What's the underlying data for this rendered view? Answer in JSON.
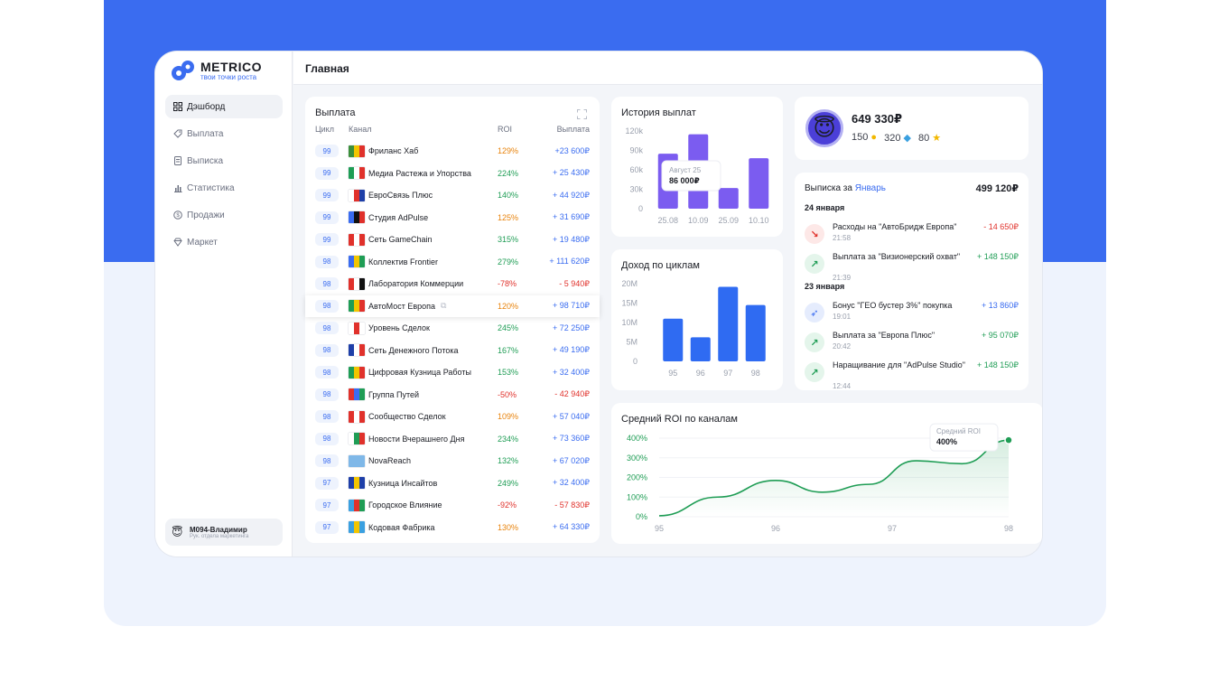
{
  "app": {
    "logo_title": "METRICO",
    "logo_subtitle": "твои точки роста",
    "accent": "#3a6cf0"
  },
  "header": {
    "title": "Главная"
  },
  "sidebar": {
    "items": [
      {
        "label": "Дэшборд",
        "icon": "dashboard-icon",
        "active": true
      },
      {
        "label": "Выплата",
        "icon": "tag-icon"
      },
      {
        "label": "Выписка",
        "icon": "document-icon"
      },
      {
        "label": "Статистика",
        "icon": "bar-chart-icon"
      },
      {
        "label": "Продажи",
        "icon": "coin-icon"
      },
      {
        "label": "Маркет",
        "icon": "diamond-icon"
      }
    ],
    "user": {
      "name": "M094-Владимир",
      "role": "Рук. отдела маркетинга"
    }
  },
  "payouts": {
    "title": "Выплата",
    "columns": [
      "Цикл",
      "Канал",
      "ROI",
      "Выплата"
    ],
    "rows": [
      {
        "cycle": "99",
        "channel": "Фриланс Хаб",
        "roi": "129%",
        "amount": "+23 600₽",
        "tone": "orange",
        "flag": [
          "#3b8f3b",
          "#f2c500",
          "#e0312b"
        ]
      },
      {
        "cycle": "99",
        "channel": "Медиа Растежа и Упорства",
        "roi": "224%",
        "amount": "+ 25 430₽",
        "tone": "green",
        "flag": [
          "#1f9d55",
          "#ffffff",
          "#e0312b"
        ]
      },
      {
        "cycle": "99",
        "channel": "ЕвроСвязь Плюс",
        "roi": "140%",
        "amount": "+ 44 920₽",
        "tone": "green",
        "flag": [
          "#ffffff",
          "#e0312b",
          "#1e3fa8"
        ]
      },
      {
        "cycle": "99",
        "channel": "Студия AdPulse",
        "roi": "125%",
        "amount": "+ 31 690₽",
        "tone": "orange",
        "flag": [
          "#3a6cf0",
          "#111111",
          "#e0312b"
        ]
      },
      {
        "cycle": "99",
        "channel": "Сеть GameChain",
        "roi": "315%",
        "amount": "+ 19 480₽",
        "tone": "green",
        "flag": [
          "#e0312b",
          "#ffffff",
          "#e0312b"
        ]
      },
      {
        "cycle": "98",
        "channel": "Коллектив Frontier",
        "roi": "279%",
        "amount": "+ 111 620₽",
        "tone": "green",
        "flag": [
          "#3a6cf0",
          "#f2c500",
          "#1f9d55"
        ]
      },
      {
        "cycle": "98",
        "channel": "Лаборатория Коммерции",
        "roi": "-78%",
        "amount": "- 5 940₽",
        "tone": "red",
        "flag": [
          "#e0312b",
          "#ffffff",
          "#111111"
        ]
      },
      {
        "cycle": "98",
        "channel": "АвтоМост Европа",
        "roi": "120%",
        "amount": "+ 98 710₽",
        "tone": "orange",
        "flag": [
          "#1f9d55",
          "#f2c500",
          "#e0312b"
        ]
      },
      {
        "cycle": "98",
        "channel": "Уровень Сделок",
        "roi": "245%",
        "amount": "+ 72 250₽",
        "tone": "green",
        "flag": [
          "#ffffff",
          "#e0312b",
          "#ffffff"
        ]
      },
      {
        "cycle": "98",
        "channel": "Сеть Денежного Потока",
        "roi": "167%",
        "amount": "+ 49 190₽",
        "tone": "green",
        "flag": [
          "#1e3fa8",
          "#ffffff",
          "#e0312b"
        ]
      },
      {
        "cycle": "98",
        "channel": "Цифровая Кузница Работы",
        "roi": "153%",
        "amount": "+ 32 400₽",
        "tone": "green",
        "flag": [
          "#1f9d55",
          "#f2c500",
          "#e0312b"
        ]
      },
      {
        "cycle": "98",
        "channel": "Группа Путей",
        "roi": "-50%",
        "amount": "- 42 940₽",
        "tone": "red",
        "flag": [
          "#e0312b",
          "#3a6cf0",
          "#1f9d55"
        ]
      },
      {
        "cycle": "98",
        "channel": "Сообщество Сделок",
        "roi": "109%",
        "amount": "+ 57 040₽",
        "tone": "orange",
        "flag": [
          "#e0312b",
          "#ffffff",
          "#e0312b"
        ]
      },
      {
        "cycle": "98",
        "channel": "Новости Вчерашнего Дня",
        "roi": "234%",
        "amount": "+ 73 360₽",
        "tone": "green",
        "flag": [
          "#ffffff",
          "#1f9d55",
          "#e0312b"
        ]
      },
      {
        "cycle": "98",
        "channel": "NovaReach",
        "roi": "132%",
        "amount": "+ 67 020₽",
        "tone": "green",
        "flag": [
          "#7fb8e8",
          "#7fb8e8",
          "#7fb8e8"
        ]
      },
      {
        "cycle": "97",
        "channel": "Кузница Инсайтов",
        "roi": "249%",
        "amount": "+ 32 400₽",
        "tone": "green",
        "flag": [
          "#1e3fa8",
          "#f2c500",
          "#1e3fa8"
        ]
      },
      {
        "cycle": "97",
        "channel": "Городское Влияние",
        "roi": "-92%",
        "amount": "- 57 830₽",
        "tone": "red",
        "flag": [
          "#3aa0e0",
          "#e0312b",
          "#1f9d55"
        ]
      },
      {
        "cycle": "97",
        "channel": "Кодовая Фабрика",
        "roi": "130%",
        "amount": "+ 64 330₽",
        "tone": "orange",
        "flag": [
          "#3aa0e0",
          "#f2c500",
          "#3aa0e0"
        ]
      }
    ]
  },
  "balance": {
    "amount": "649 330₽",
    "coins": "150",
    "gems": "320",
    "stars": "80"
  },
  "statement": {
    "title": "Выписка за",
    "month": "Январь",
    "total": "499 120₽",
    "groups": [
      {
        "date": "24 января",
        "items": [
          {
            "title": "Расходы на \"АвтоБридж Европа\"",
            "time": "21:58",
            "amount": "- 14 650₽",
            "tone": "red",
            "icon": "arrow-down-right-icon"
          },
          {
            "title": "Выплата за \"Визионерский охват\"",
            "time": "21:39",
            "amount": "+ 148 150₽",
            "tone": "green",
            "icon": "arrow-up-right-icon"
          }
        ]
      },
      {
        "date": "23 января",
        "items": [
          {
            "title": "Бонус \"ГЕО бустер 3%\" покупка",
            "time": "19:01",
            "amount": "+ 13 860₽",
            "tone": "blue",
            "icon": "rocket-icon"
          },
          {
            "title": "Выплата за \"Европа Плюс\"",
            "time": "20:42",
            "amount": "+ 95 070₽",
            "tone": "green",
            "icon": "arrow-up-right-icon"
          },
          {
            "title": "Наращивание для \"AdPulse Studio\"",
            "time": "12:44",
            "amount": "+ 148 150₽",
            "tone": "green",
            "icon": "arrow-up-right-icon"
          }
        ]
      }
    ]
  },
  "chart_data": [
    {
      "id": "history",
      "type": "bar",
      "title": "История выплат",
      "categories": [
        "25.08",
        "10.09",
        "25.09",
        "10.10"
      ],
      "values": [
        85000,
        115000,
        32000,
        78000
      ],
      "y_ticks": [
        "0",
        "30k",
        "60k",
        "90k",
        "120k"
      ],
      "ylim": [
        0,
        120000
      ],
      "tooltip": {
        "label": "Август 25",
        "value": "86 000₽"
      },
      "color": "#7b5cf0"
    },
    {
      "id": "income",
      "type": "bar",
      "title": "Доход по циклам",
      "categories": [
        "95",
        "96",
        "97",
        "98"
      ],
      "values": [
        11000000,
        6200000,
        19200000,
        14500000
      ],
      "y_ticks": [
        "0",
        "5M",
        "10M",
        "15M",
        "20M"
      ],
      "ylim": [
        0,
        20000000
      ],
      "color": "#2f6bf2"
    },
    {
      "id": "roi",
      "type": "area",
      "title": "Средний ROI по каналам",
      "x": [
        95,
        95.5,
        96,
        96.4,
        96.8,
        97.2,
        97.6,
        98
      ],
      "values": [
        5,
        100,
        185,
        125,
        165,
        285,
        270,
        390
      ],
      "x_ticks": [
        "95",
        "96",
        "97",
        "98"
      ],
      "y_ticks": [
        "0%",
        "100%",
        "200%",
        "300%",
        "400%"
      ],
      "ylim": [
        0,
        400
      ],
      "tooltip": {
        "label": "Средний ROI",
        "value": "400%"
      },
      "color": "#1f9d55"
    }
  ]
}
